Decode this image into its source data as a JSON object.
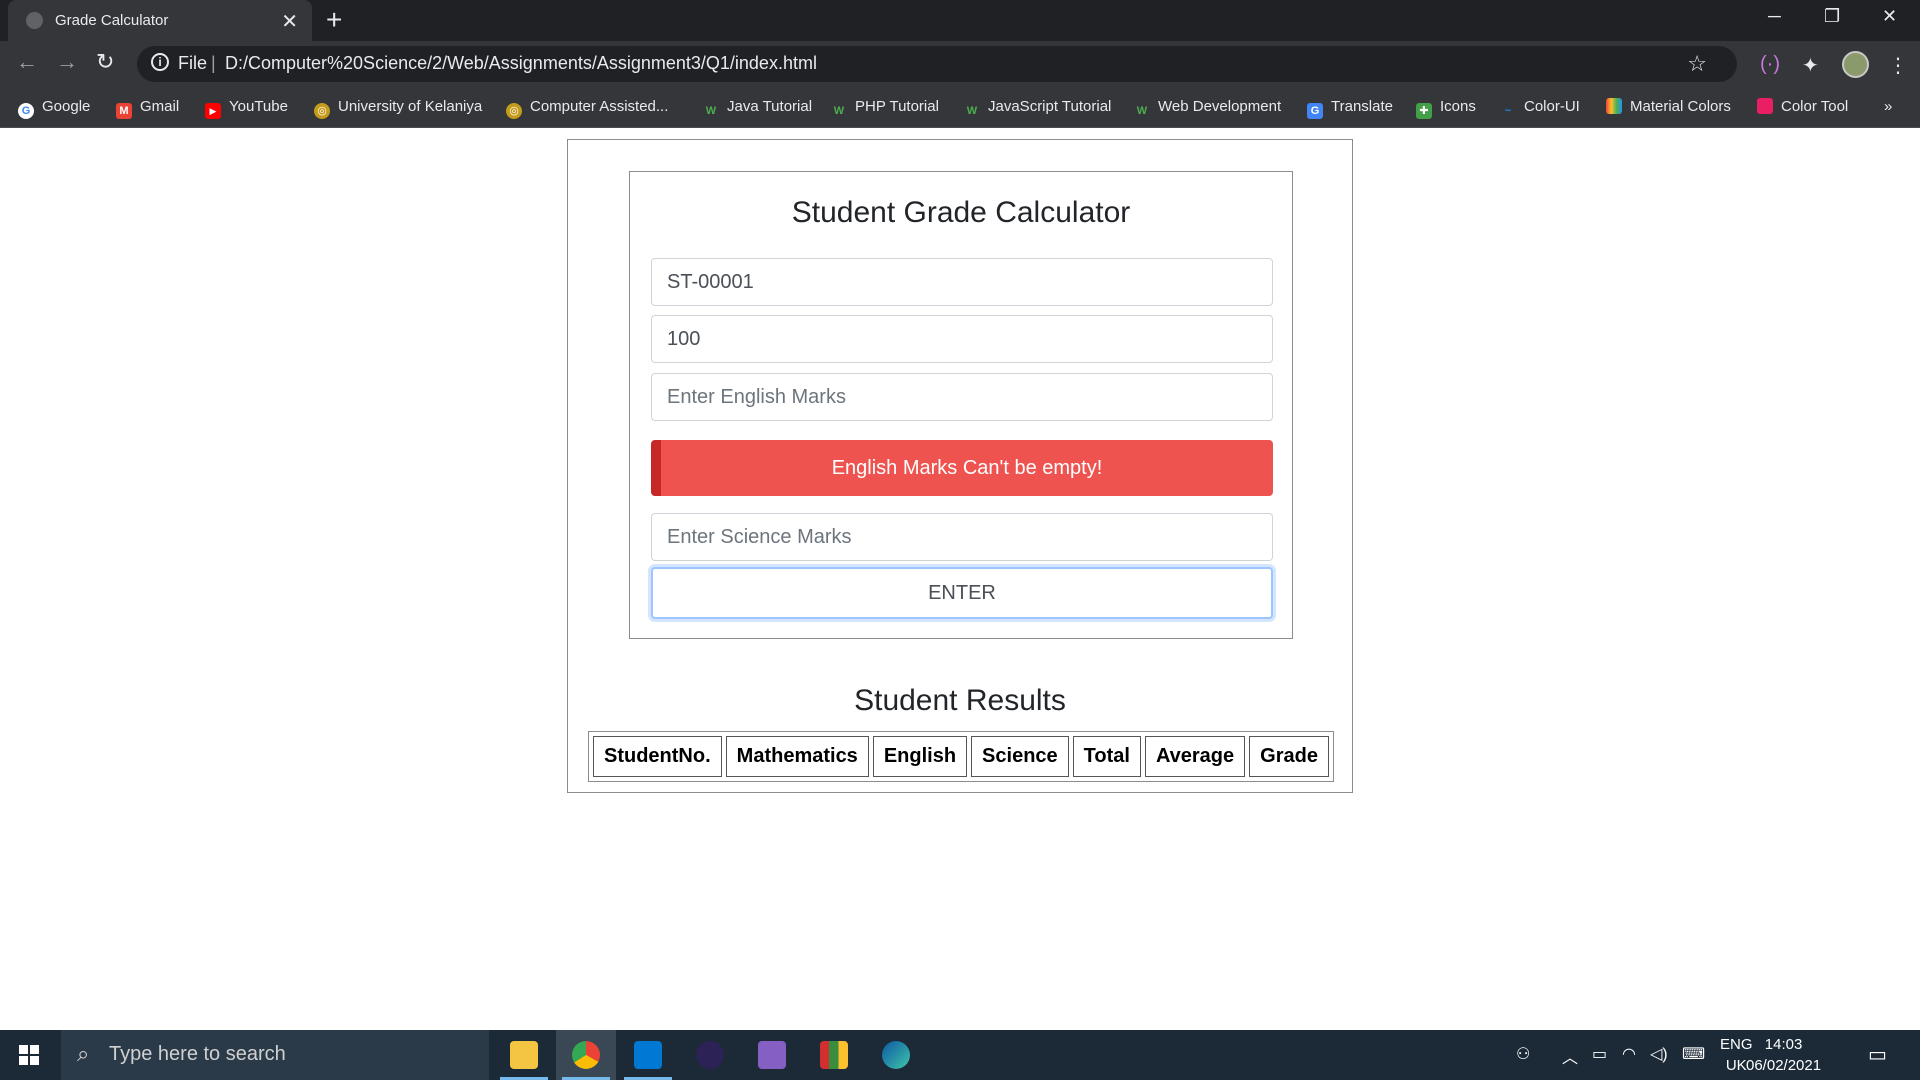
{
  "browser": {
    "tab_title": "Grade Calculator",
    "tab_close": "✕",
    "new_tab": "+",
    "scheme_label": "File",
    "url": "D:/Computer%20Science/2/Web/Assignments/Assignment3/Q1/index.html",
    "window_controls": {
      "minimize": "─",
      "restore": "❐",
      "close": "✕"
    },
    "bookmarks": [
      {
        "label": "Google",
        "color": "#4285f4",
        "glyph": "G"
      },
      {
        "label": "Gmail",
        "color": "#ea4335",
        "glyph": "M"
      },
      {
        "label": "YouTube",
        "color": "#ff0000",
        "glyph": "▶"
      },
      {
        "label": "University of Kelaniya",
        "color": "#c59b1a",
        "glyph": "◎"
      },
      {
        "label": "Computer Assisted...",
        "color": "#c59b1a",
        "glyph": "◎"
      },
      {
        "label": "Java Tutorial",
        "color": "#2e7d32",
        "glyph": "W"
      },
      {
        "label": "PHP Tutorial",
        "color": "#2e7d32",
        "glyph": "W"
      },
      {
        "label": "JavaScript Tutorial",
        "color": "#2e7d32",
        "glyph": "W"
      },
      {
        "label": "Web Development",
        "color": "#2e7d32",
        "glyph": "W"
      },
      {
        "label": "Translate",
        "color": "#4285f4",
        "glyph": "G"
      },
      {
        "label": "Icons",
        "color": "#43a047",
        "glyph": "✚"
      },
      {
        "label": "Color-UI",
        "color": "#1e88e5",
        "glyph": "~"
      },
      {
        "label": "Material Colors",
        "color": "#fbc02d",
        "glyph": "■"
      },
      {
        "label": "Color Tool",
        "color": "#e91e63",
        "glyph": "◆"
      }
    ],
    "overflow": "»"
  },
  "page": {
    "form_title": "Student Grade Calculator",
    "student_no_value": "ST-00001",
    "math_value": "100",
    "english_placeholder": "Enter English Marks",
    "english_error": "English Marks Can't be empty!",
    "science_placeholder": "Enter Science Marks",
    "enter_label": "ENTER",
    "results_title": "Student Results",
    "table_headers": [
      "StudentNo.",
      "Mathematics",
      "English",
      "Science",
      "Total",
      "Average",
      "Grade"
    ]
  },
  "taskbar": {
    "search_placeholder": "Type here to search",
    "language": "ENG",
    "region": "UK",
    "time": "14:03",
    "date": "06/02/2021"
  },
  "colors": {
    "alert_bg": "#ef5350",
    "alert_border": "#c62828",
    "taskbar_bg": "#1c2a38"
  }
}
